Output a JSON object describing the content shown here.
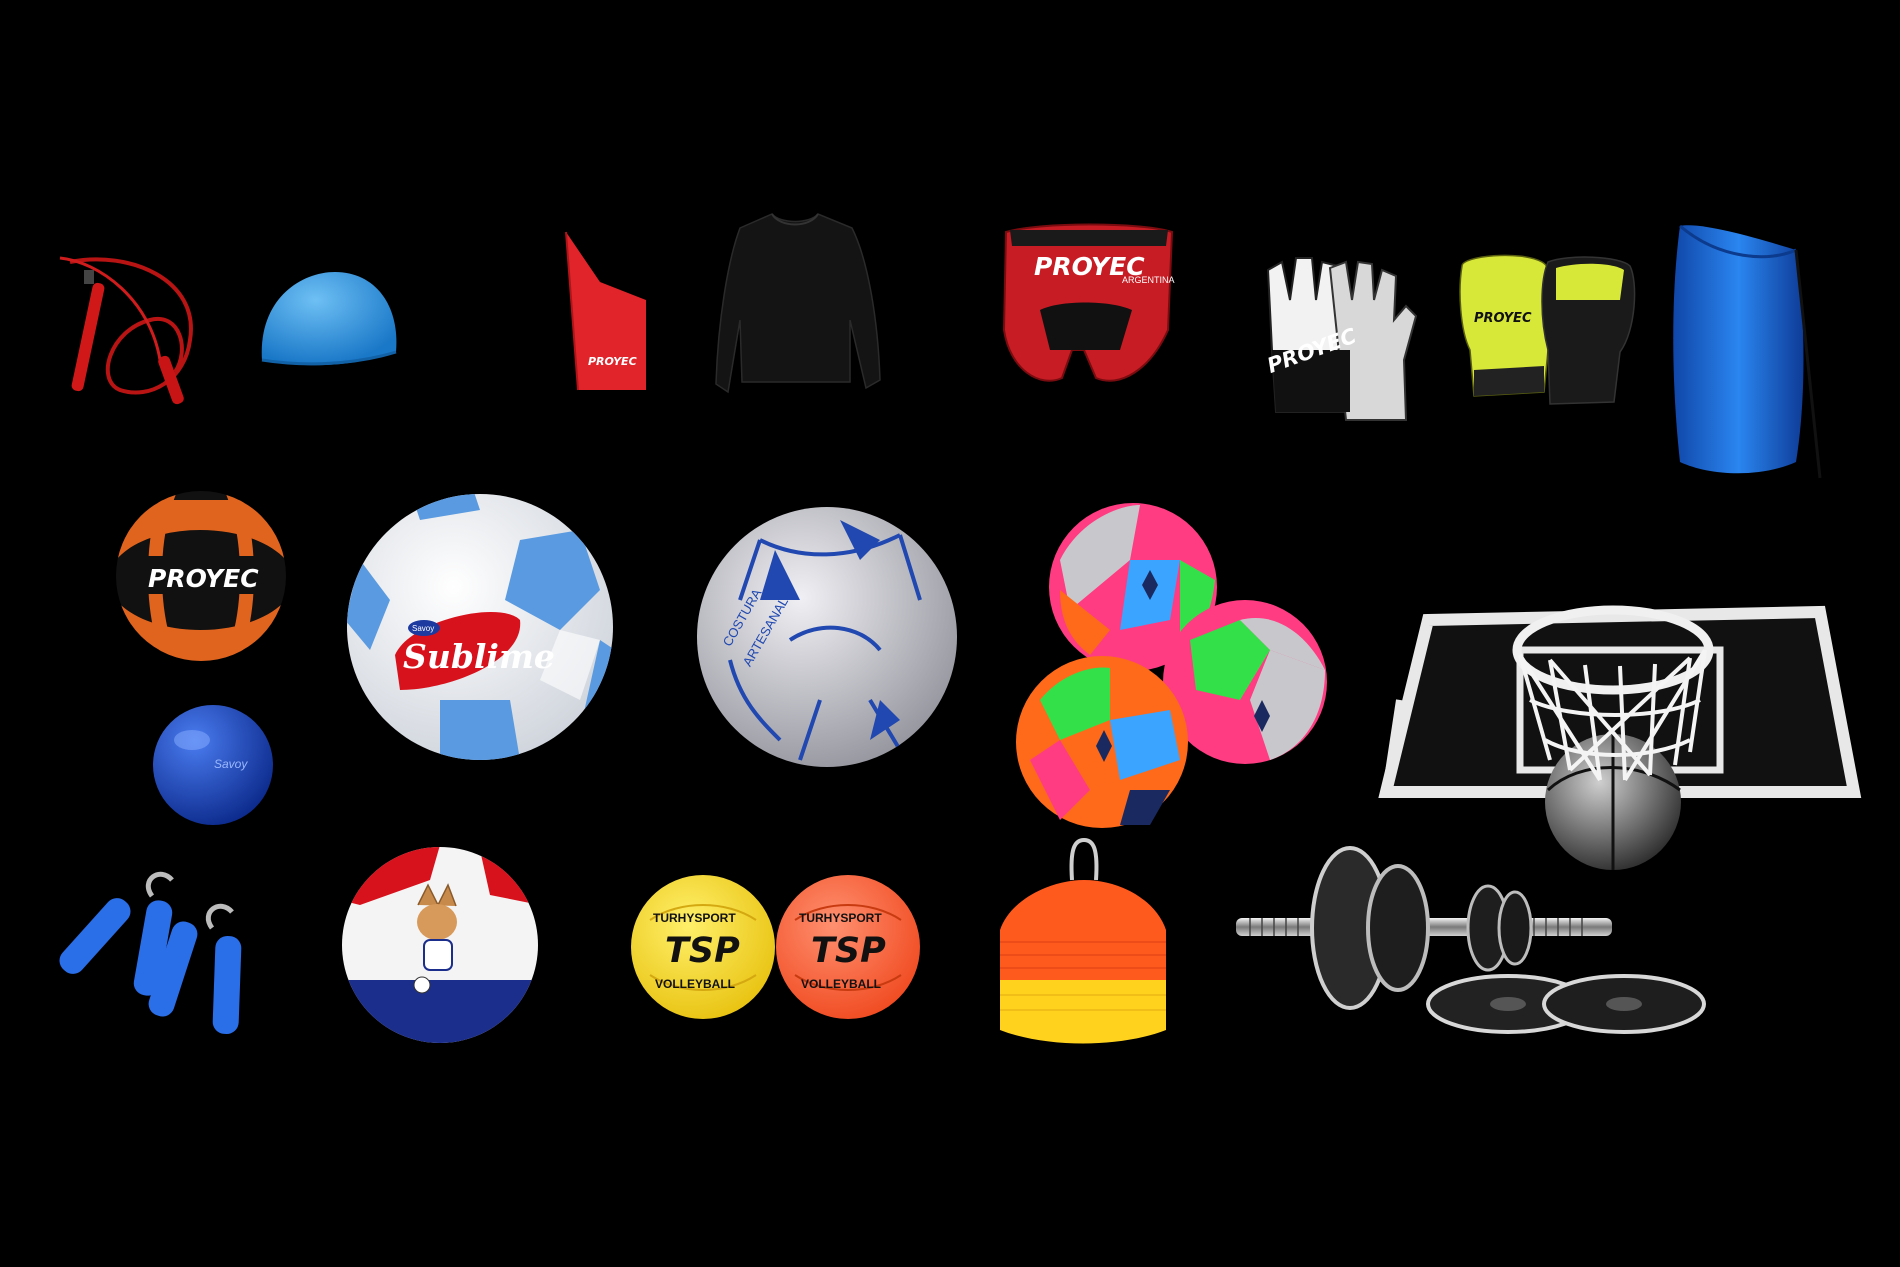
{
  "scene": {
    "background": "#000000",
    "description_free": true
  },
  "labels": {
    "proyec": "PROYEC",
    "argentina": "ARGENTINA",
    "sublime": "Sublime",
    "savoy": "Savoy",
    "turhysport": "TURHYSPORT",
    "tsp": "TSP",
    "volleyball": "VOLLEYBALL",
    "artesanal": "ARTESANAL",
    "costura": "COSTURA"
  },
  "colors": {
    "rope_red": "#c01818",
    "cap_blue": "#3a98dc",
    "red_band": "#e0242a",
    "shirt_black": "#141414",
    "headgear_red": "#c81c24",
    "glove_white": "#f2f2f2",
    "glove_yellow": "#d8e838",
    "bag_blue": "#1e6ed8",
    "med_ball_orange": "#e0641e",
    "small_ball_blue": "#1c4ac8",
    "soccer_blue": "#5a9ae0",
    "silver": "#c8c8cc",
    "neon_orange": "#ff6a1a",
    "neon_pink": "#ff3c82",
    "neon_green": "#34e04a",
    "neon_blue": "#3aa4ff",
    "grip_blue": "#2a6ee8",
    "volley_yellow": "#f5d829",
    "volley_orange": "#ff6a3a",
    "cone_orange": "#ff5a1e",
    "cone_yellow": "#ffd21e"
  }
}
